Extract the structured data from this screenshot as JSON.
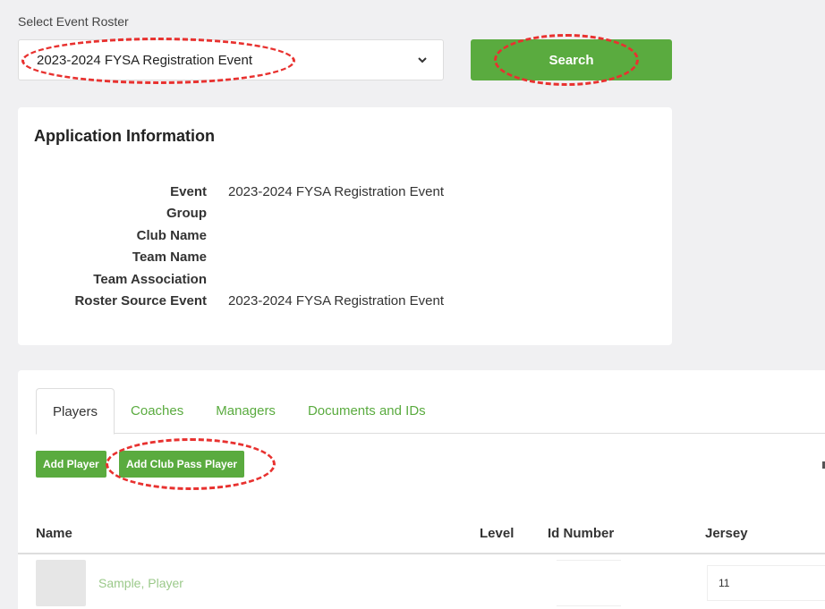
{
  "roster_select": {
    "label": "Select Event Roster",
    "selected": "2023-2024 FYSA Registration Event"
  },
  "search_button": "Search",
  "application_info": {
    "title": "Application Information",
    "rows": [
      {
        "key": "Event",
        "value": "2023-2024 FYSA Registration Event"
      },
      {
        "key": "Group",
        "value": ""
      },
      {
        "key": "Club Name",
        "value": ""
      },
      {
        "key": "Team Name",
        "value": ""
      },
      {
        "key": "Team Association",
        "value": ""
      },
      {
        "key": "Roster Source Event",
        "value": "2023-2024 FYSA Registration Event"
      }
    ]
  },
  "tabs": [
    {
      "label": "Players",
      "active": true
    },
    {
      "label": "Coaches",
      "active": false
    },
    {
      "label": "Managers",
      "active": false
    },
    {
      "label": "Documents and IDs",
      "active": false
    }
  ],
  "actions": {
    "add_player": "Add Player",
    "add_club_pass_player": "Add Club Pass Player"
  },
  "table": {
    "columns": [
      "Name",
      "Level",
      "Id Number",
      "Jersey"
    ],
    "rows": [
      {
        "name": "Sample, Player",
        "level": "",
        "id_number": "",
        "jersey": "11"
      }
    ]
  },
  "colors": {
    "accent_green": "#5aab3f",
    "annotation_red": "#e8312f"
  },
  "icons": {
    "select_caret": "chevron-down-icon",
    "player_photo": "avatar"
  }
}
